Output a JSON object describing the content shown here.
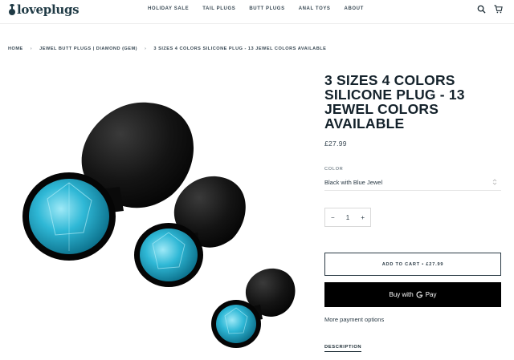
{
  "header": {
    "logo_text": "loveplugs",
    "nav": [
      "HOLIDAY SALE",
      "TAIL PLUGS",
      "BUTT PLUGS",
      "ANAL TOYS",
      "ABOUT"
    ],
    "icons": [
      "search-icon",
      "cart-icon"
    ]
  },
  "breadcrumb": {
    "items": [
      "HOME",
      "JEWEL BUTT PLUGS | DIAMOND (GEM)",
      "3 SIZES 4 COLORS SILICONE PLUG - 13 JEWEL COLORS AVAILABLE"
    ],
    "separator": "›"
  },
  "product": {
    "title": "3 SIZES 4 COLORS SILICONE PLUG - 13 JEWEL COLORS AVAILABLE",
    "price": "£27.99",
    "image_alt_icon": "product-photo",
    "colors": {
      "plug": "#0d0d0d",
      "jewel": "#2fb8d6"
    }
  },
  "options": {
    "color_label": "COLOR",
    "color_value": "Black with Blue Jewel"
  },
  "quantity": {
    "minus": "−",
    "value": "1",
    "plus": "+"
  },
  "buttons": {
    "add_to_cart": "ADD TO CART • £27.99",
    "buy_with": "Buy with",
    "gpay": "Pay",
    "more_payment": "More payment options"
  },
  "tabs": {
    "description": "DESCRIPTION"
  }
}
